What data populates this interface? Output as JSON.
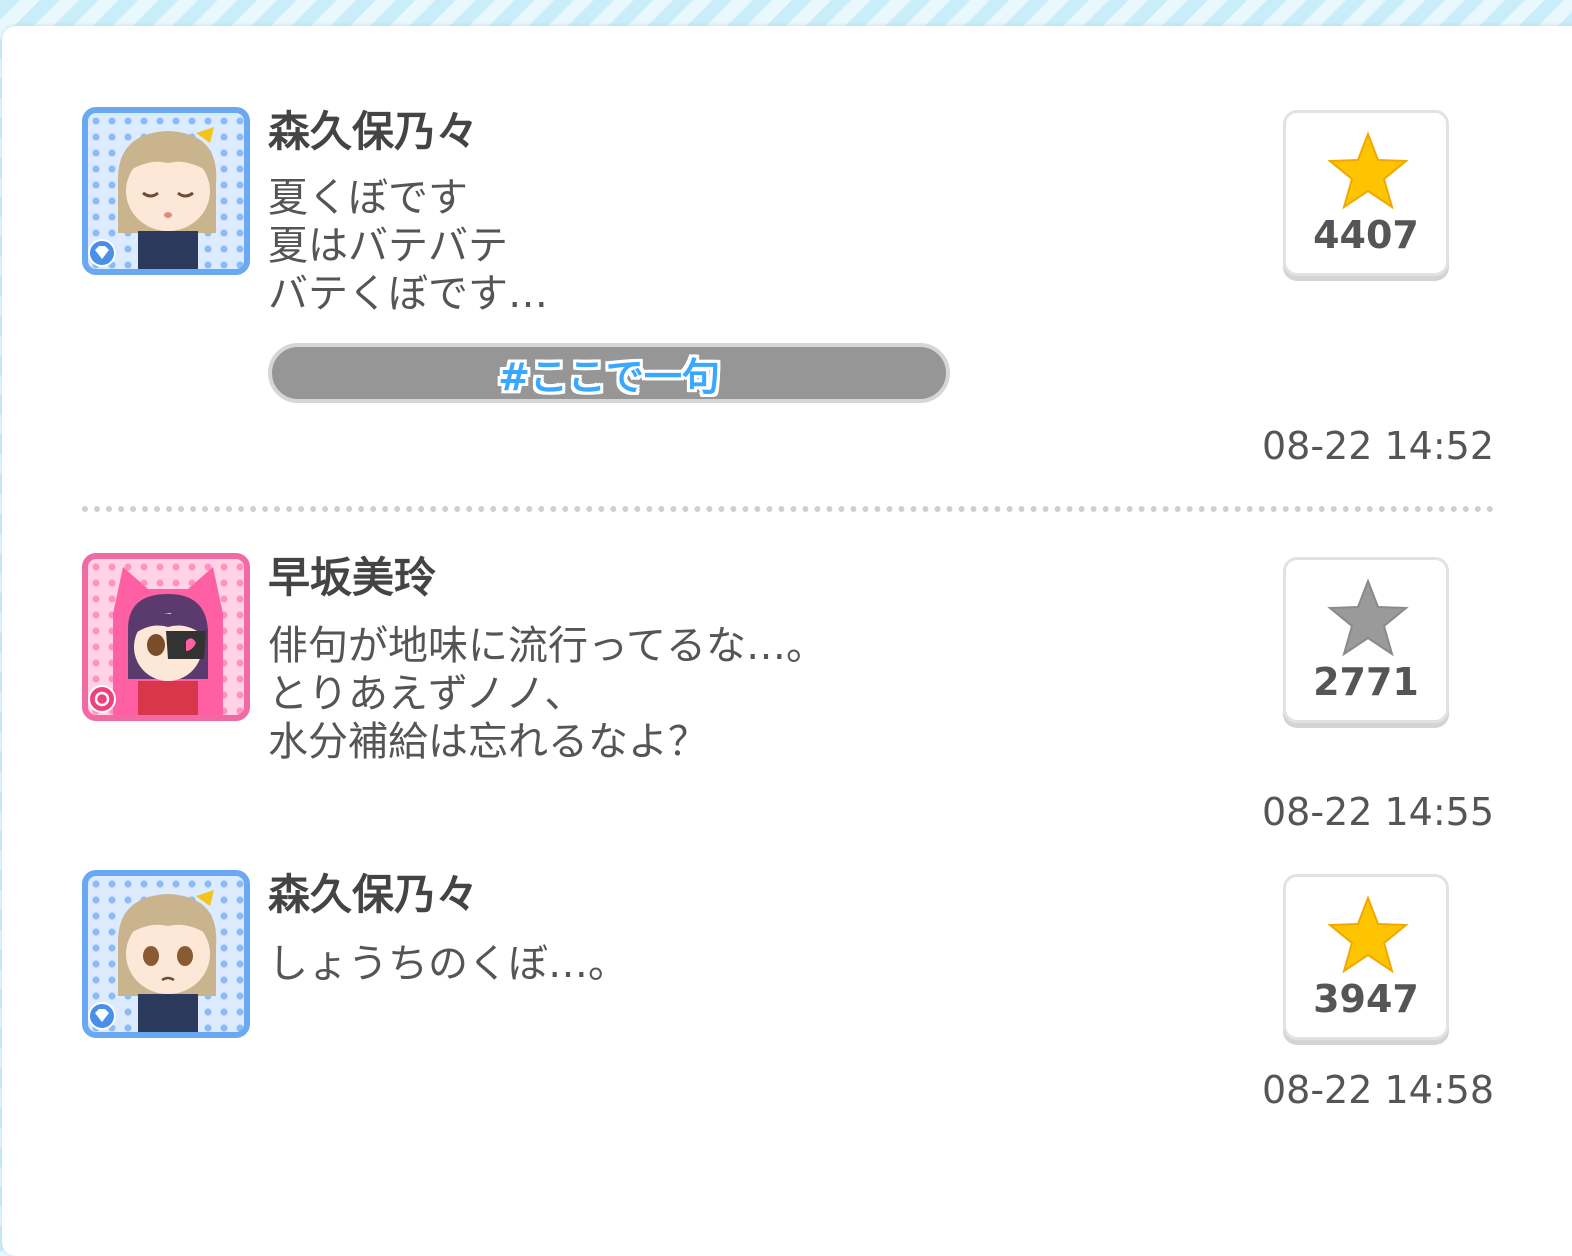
{
  "posts": [
    {
      "name": "森久保乃々",
      "lines": [
        "夏くぼです",
        "夏はバテバテ",
        "バテくぼです…"
      ],
      "hashtag": "#ここで一句",
      "likes": "4407",
      "liked": true,
      "time": "08-22 14:52",
      "avatar_theme": "blue"
    },
    {
      "name": "早坂美玲",
      "lines": [
        "俳句が地味に流行ってるな…。",
        "とりあえずノノ、",
        "水分補給は忘れるなよ？"
      ],
      "likes": "2771",
      "liked": false,
      "time": "08-22 14:55",
      "avatar_theme": "pink"
    },
    {
      "name": "森久保乃々",
      "lines": [
        "しょうちのくぼ…。"
      ],
      "likes": "3947",
      "liked": true,
      "time": "08-22 14:58",
      "avatar_theme": "blue"
    }
  ],
  "colors": {
    "star_active": "#ffc400",
    "star_inactive": "#9a9a9a",
    "hashtag_text": "#3aa8ff",
    "avatar_blue_border": "#6aa8f2",
    "avatar_pink_border": "#f06aa3"
  }
}
